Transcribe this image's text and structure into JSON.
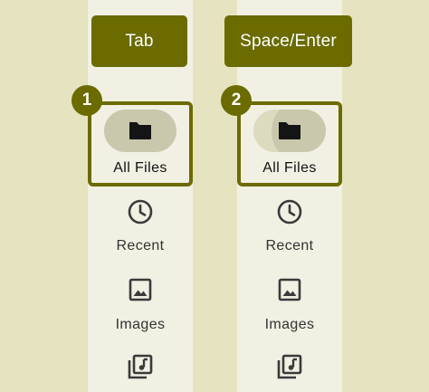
{
  "colors": {
    "accent": "#6b6b00",
    "page_bg": "#e6e3c0",
    "column_bg": "#f2f0e2",
    "pill_bg": "#c9c7ac",
    "icon": "#3a3a3a"
  },
  "panels": [
    {
      "key_label": "Tab",
      "step": "1",
      "selected_item": {
        "label": "All Files",
        "icon": "folder-icon"
      },
      "items": [
        {
          "label": "Recent",
          "icon": "clock-icon"
        },
        {
          "label": "Images",
          "icon": "image-icon"
        },
        {
          "label": "",
          "icon": "audio-library-icon"
        }
      ]
    },
    {
      "key_label": "Space/Enter",
      "step": "2",
      "selected_item": {
        "label": "All Files",
        "icon": "folder-icon"
      },
      "items": [
        {
          "label": "Recent",
          "icon": "clock-icon"
        },
        {
          "label": "Images",
          "icon": "image-icon"
        },
        {
          "label": "",
          "icon": "audio-library-icon"
        }
      ]
    }
  ]
}
